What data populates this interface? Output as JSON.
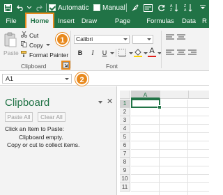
{
  "titlebar": {
    "autosave_label": "Automatic",
    "manual_label": "Manual",
    "autosave_checked": true,
    "manual_checked": false,
    "icons": [
      "save-icon",
      "undo-icon",
      "redo-icon",
      "paint-icon",
      "format-icon",
      "sync-icon",
      "sort-az-icon",
      "sort-za-icon"
    ]
  },
  "tabs": {
    "file": "File",
    "home": "Home",
    "insert": "Insert",
    "draw": "Draw",
    "page_layout": "Page Layout",
    "formulas": "Formulas",
    "data": "Data",
    "review": "R"
  },
  "ribbon": {
    "clipboard": {
      "paste": "Paste",
      "cut": "Cut",
      "copy": "Copy",
      "format_painter": "Format Painter",
      "group_label": "Clipboard"
    },
    "font": {
      "font_name": "Calibri",
      "bold": "B",
      "italic": "I",
      "underline": "U",
      "font_color_letter": "A",
      "group_label": "Font"
    }
  },
  "formula_bar": {
    "name_box": "A1"
  },
  "clipboard_pane": {
    "title": "Clipboard",
    "paste_all": "Paste All",
    "clear_all": "Clear All",
    "instruction": "Click an Item to Paste:",
    "empty_line1": "Clipboard empty.",
    "empty_line2": "Copy or cut to collect items.",
    "close_glyph": "✕"
  },
  "grid": {
    "columns": [
      "A"
    ],
    "rows": [
      "1",
      "2",
      "3",
      "4",
      "5",
      "6",
      "7",
      "8",
      "9",
      "10",
      "11"
    ],
    "active_cell": "A1"
  },
  "callouts": {
    "step1": "1",
    "step2": "2"
  },
  "colors": {
    "excel_green": "#217346",
    "highlight_orange": "#e8891d",
    "ribbon_bg": "#f3f3f3"
  }
}
